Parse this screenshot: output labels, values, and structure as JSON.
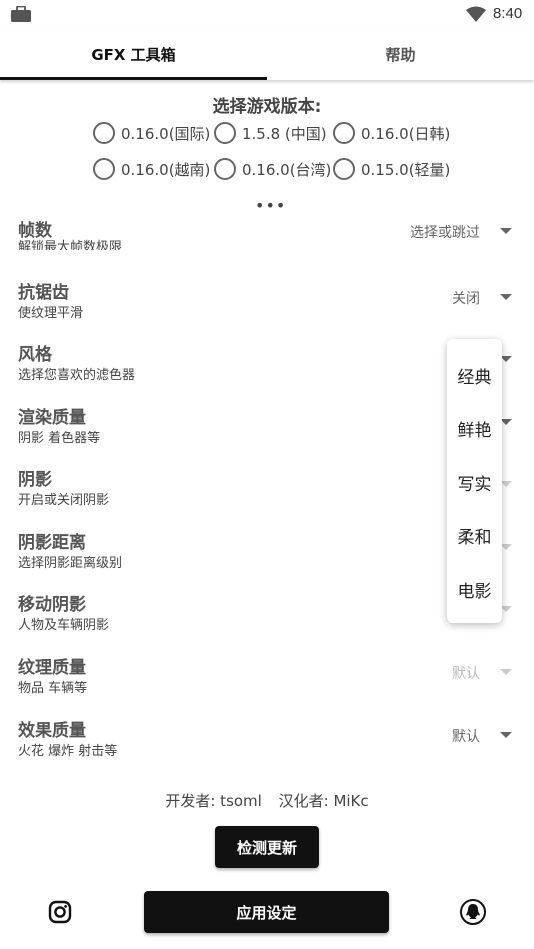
{
  "statusbar": {
    "time": "8:40",
    "icons": [
      "briefcase-icon",
      "wifi-icon"
    ]
  },
  "tabs": [
    {
      "label": "GFX 工具箱",
      "active": true
    },
    {
      "label": "帮助",
      "active": false
    }
  ],
  "version": {
    "title": "选择游戏版本:",
    "options": [
      "0.16.0(国际)",
      "1.5.8 (中国)",
      "0.16.0(日韩)",
      "0.16.0(越南)",
      "0.16.0(台湾)",
      "0.15.0(轻量)"
    ]
  },
  "more_label": "•••",
  "settings": [
    {
      "title": "帧数",
      "desc": "解锁最大帧数极限",
      "value": "选择或跳过"
    },
    {
      "title": "抗锯齿",
      "desc": "使纹理平滑",
      "value": "关闭"
    },
    {
      "title": "风格",
      "desc": "选择您喜欢的滤色器",
      "value": ""
    },
    {
      "title": "渲染质量",
      "desc": "阴影 着色器等",
      "value": ""
    },
    {
      "title": "阴影",
      "desc": "开启或关闭阴影",
      "value": ""
    },
    {
      "title": "阴影距离",
      "desc": "选择阴影距离级别",
      "value": ""
    },
    {
      "title": "移动阴影",
      "desc": "人物及车辆阴影",
      "value": ""
    },
    {
      "title": "纹理质量",
      "desc": "物品 车辆等",
      "value": "默认"
    },
    {
      "title": "效果质量",
      "desc": "火花 爆炸 射击等",
      "value": "默认"
    }
  ],
  "style_dropdown": {
    "options": [
      "经典",
      "鲜艳",
      "写实",
      "柔和",
      "电影"
    ]
  },
  "credits": {
    "developer": "开发者: tsoml",
    "translator": "汉化者: MiKc"
  },
  "buttons": {
    "check_update": "检测更新",
    "apply": "应用设定"
  },
  "footer_icons": [
    "instagram-icon",
    "qq-icon"
  ]
}
